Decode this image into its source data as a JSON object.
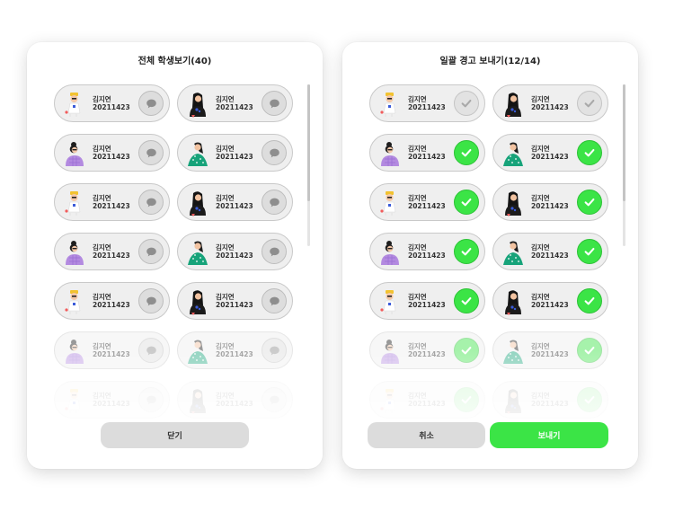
{
  "left_panel": {
    "title": "전체 학생보기(40)",
    "close_label": "닫기"
  },
  "right_panel": {
    "title": "일괄 경고 보내기(12/14)",
    "cancel_label": "취소",
    "send_label": "보내기"
  },
  "student": {
    "name": "김지연",
    "id": "20211423"
  },
  "colors": {
    "accent_green": "#3be446",
    "card_bg": "#efefef",
    "card_border": "#c9c9c9"
  },
  "avatar_styles": [
    "yellow-hat",
    "purple-sweater",
    "black-hair-dark",
    "green-dress"
  ],
  "icons": {
    "message": "chat-bubble-icon",
    "check": "checkmark-icon"
  }
}
